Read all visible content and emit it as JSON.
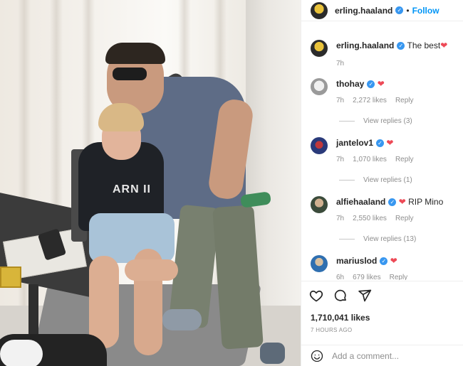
{
  "post": {
    "image_alt": "Photo of two people posing together in a room",
    "shirt_text": "ARN II"
  },
  "header": {
    "username": "erling.haaland",
    "separator": "•",
    "follow_label": "Follow"
  },
  "caption": {
    "username": "erling.haaland",
    "text": "The best",
    "emoji": "❤",
    "time": "7h"
  },
  "comments": [
    {
      "username": "thohay",
      "text": "",
      "emoji": "❤",
      "time": "7h",
      "likes": "2,272 likes",
      "reply": "Reply",
      "view_replies": "View replies (3)"
    },
    {
      "username": "jantelov1",
      "text": "",
      "emoji": "❤",
      "time": "7h",
      "likes": "1,070 likes",
      "reply": "Reply",
      "view_replies": "View replies (1)"
    },
    {
      "username": "alfiehaaland",
      "text": "RIP Mino",
      "emoji": "❤",
      "time": "7h",
      "likes": "2,550 likes",
      "reply": "Reply",
      "view_replies": "View replies (13)"
    },
    {
      "username": "mariuslod",
      "text": "",
      "emoji": "❤",
      "time": "6h",
      "likes": "679 likes",
      "reply": "Reply",
      "view_replies": ""
    }
  ],
  "actions": {
    "like_count": "1,710,041 likes",
    "timestamp": "7 HOURS AGO",
    "icons": [
      "heart-icon",
      "comment-icon",
      "share-icon"
    ]
  },
  "composer": {
    "placeholder": "Add a comment..."
  },
  "colors": {
    "accent": "#0095f6",
    "verified": "#3897f0",
    "heart": "#ed4956",
    "muted": "#8e8e8e"
  }
}
